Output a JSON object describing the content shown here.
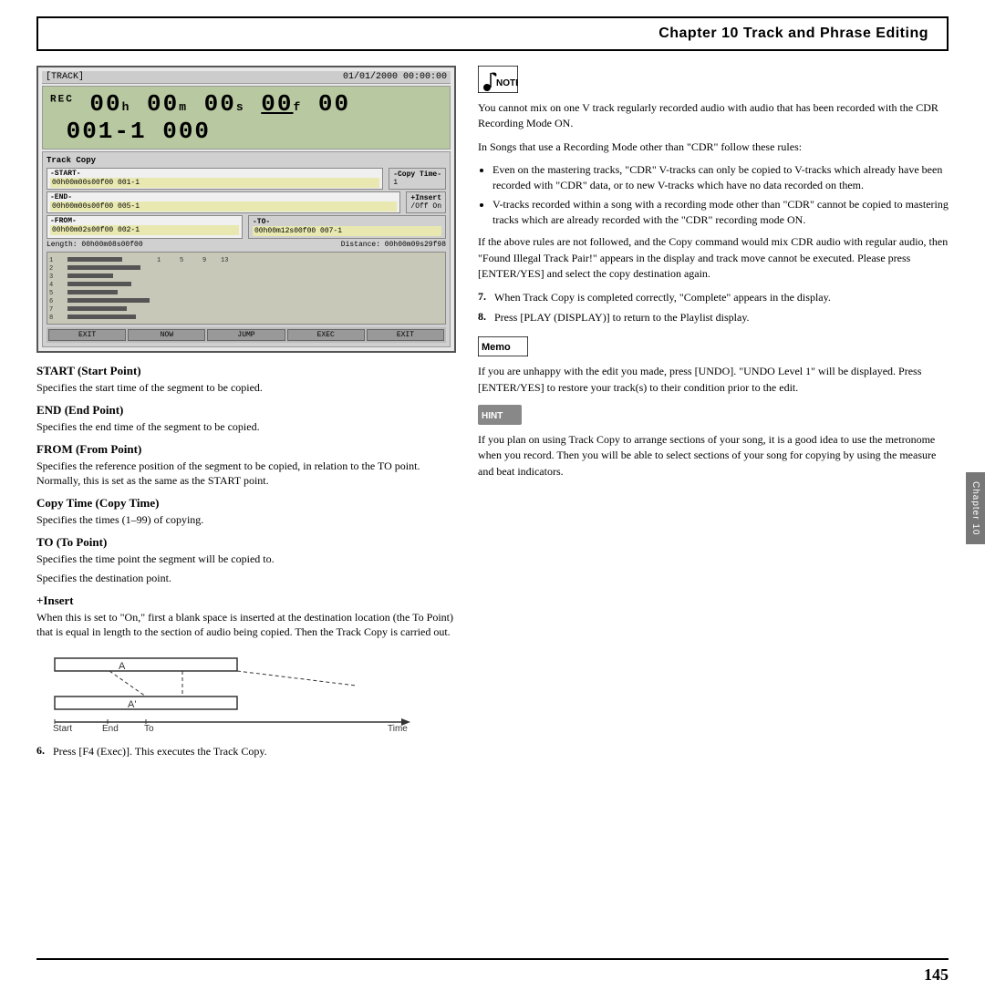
{
  "header": {
    "title": "Chapter 10  Track and Phrase Editing"
  },
  "device": {
    "top_bar_left": "[TRACK]",
    "top_bar_right": "01/01/2000 00:00:00",
    "main_display": "00h 00m 00s 00f 00  001-1 000",
    "panel_title": "Track Copy",
    "start_label": "-START-",
    "start_value": "00h00m00s00f00 001-1",
    "end_label": "-END-",
    "end_value": "00h00m00s00f00 005-1",
    "from_label": "-FROM-",
    "from_value": "00h00m02s00f00 002-1",
    "copy_time_label": "-Copy Time-",
    "copy_time_value": "1",
    "insert_label": "+Insert",
    "insert_value": "/Off  On",
    "to_label": "-TO-",
    "to_value": "00h00m12s00f00 007-1",
    "length_label": "Length: 00h00m08s00f00",
    "distance_label": "Distance: 00h00m09s29f98",
    "buttons": [
      "EXIT",
      "NOW",
      "JUMP",
      "EXEC",
      "EXIT"
    ]
  },
  "left_content": {
    "start_heading": "START (Start Point)",
    "start_text": "Specifies the start time of the segment to be copied.",
    "end_heading": "END (End Point)",
    "end_text": "Specifies the end time of the segment to be copied.",
    "from_heading": "FROM (From Point)",
    "from_text": "Specifies the reference position of the segment to be copied, in relation to the TO point. Normally, this is set as the same as the START point.",
    "copy_time_heading": "Copy Time (Copy Time)",
    "copy_time_text": "Specifies the times (1–99) of copying.",
    "to_heading": "TO (To Point)",
    "to_text1": "Specifies the time point the segment will be copied to.",
    "to_text2": "Specifies the destination point.",
    "insert_heading": "+Insert",
    "insert_text": "When this is set to \"On,\" first a blank space is inserted at the destination location (the To Point) that is equal in length to the section of audio being copied. Then the Track Copy is carried out.",
    "diagram_a_label": "A",
    "diagram_a_prime": "A'",
    "diagram_start": "Start",
    "diagram_end": "End",
    "diagram_to": "To",
    "diagram_time": "Time",
    "step6_num": "6.",
    "step6_text": "Press [F4 (Exec)]. This executes the Track Copy."
  },
  "right_content": {
    "note_intro": "You cannot mix on one V track regularly recorded audio with audio that has been recorded with the CDR Recording Mode ON.",
    "note_para2": "In Songs that use a Recording Mode other than \"CDR\" follow these rules:",
    "bullet1": "Even on the mastering tracks, \"CDR\" V-tracks can only be copied to V-tracks which already have been recorded with \"CDR\" data, or to new V-tracks which have no data recorded on them.",
    "bullet2": "V-tracks recorded within a song with a recording mode other than \"CDR\" cannot be copied to mastering tracks which are already recorded with the \"CDR\" recording mode ON.",
    "para_rules": "If the above rules are not followed, and the Copy command would mix CDR audio with regular audio, then \"Found Illegal Track Pair!\" appears in the display and track move cannot be executed. Please press [ENTER/YES] and select the copy destination again.",
    "step7_num": "7.",
    "step7_text": "When Track Copy is completed correctly, \"Complete\" appears in the display.",
    "step8_num": "8.",
    "step8_text": "Press [PLAY (DISPLAY)] to return to the Playlist display.",
    "memo_text": "If you are unhappy with the edit you made, press [UNDO]. \"UNDO Level 1\" will be displayed. Press [ENTER/YES] to restore your track(s) to their condition prior to the edit.",
    "hint_text": "If you plan on using Track Copy to arrange sections of your song, it is a good idea to use the metronome when you record. Then you will be able to select sections of your song for copying by using the measure and beat indicators."
  },
  "footer": {
    "page_number": "145",
    "chapter_label": "Chapter 10"
  }
}
